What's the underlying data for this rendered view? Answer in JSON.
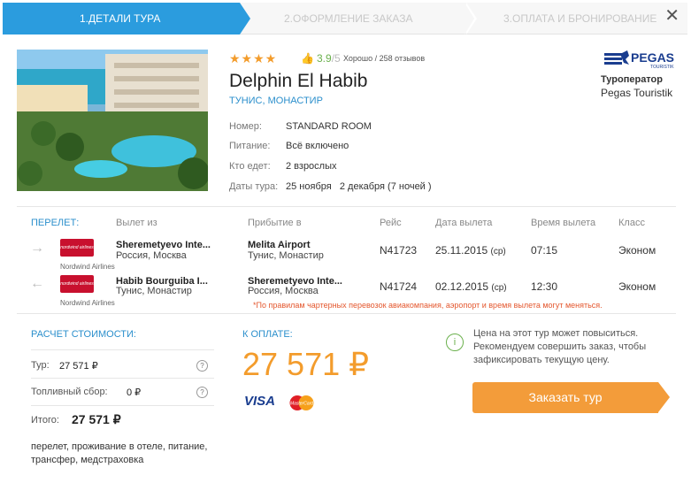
{
  "steps": [
    "1.Детали тура",
    "2.Оформление заказа",
    "3.Оплата и бронирование"
  ],
  "colors": {
    "accent": "#2b9cde",
    "orange": "#f39c3a",
    "green": "#6ab04c"
  },
  "hotel": {
    "stars": "★★★★",
    "rating": "3.9",
    "rating_of": "/5",
    "rating_text": "Хорошо / 258 отзывов",
    "name": "Delphin El Habib",
    "location": "Тунис, Монастир",
    "details": [
      {
        "label": "Номер:",
        "value": "STANDARD ROOM"
      },
      {
        "label": "Питание:",
        "value": "Всё включено"
      },
      {
        "label": "Кто едет:",
        "value": "2 взрослых"
      },
      {
        "label": "Даты тура:",
        "value": "25 ноября   2 декабря (7 ночей )"
      }
    ]
  },
  "operator": {
    "logo_text": "PEGAS",
    "logo_sub": "TOURISTIK",
    "label": "Туроператор",
    "name": "Pegas Touristik"
  },
  "flights": {
    "headers": [
      "Перелет:",
      "Вылет из",
      "Прибытие в",
      "Рейс",
      "Дата вылета",
      "Время вылета",
      "Класс"
    ],
    "rows": [
      {
        "direction": "→",
        "airline_logo": "nordwind airlines",
        "airline": "Nordwind Airlines",
        "from_name": "Sheremetyevo Inte...",
        "from_place": "Россия, Москва",
        "to_name": "Melita Airport",
        "to_place": "Тунис, Монастир",
        "flight": "N41723",
        "date": "25.11.2015",
        "day": "(ср)",
        "time": "07:15",
        "class": "Эконом"
      },
      {
        "direction": "←",
        "airline_logo": "nordwind airlines",
        "airline": "Nordwind Airlines",
        "from_name": "Habib Bourguiba I...",
        "from_place": "Тунис, Монастир",
        "to_name": "Sheremetyevo Inte...",
        "to_place": "Россия, Москва",
        "flight": "N41724",
        "date": "02.12.2015",
        "day": "(ср)",
        "time": "12:30",
        "class": "Эконом"
      }
    ],
    "warning": "*По правилам чартерных перевозок авиакомпания, аэропорт и время вылета могут меняться."
  },
  "cost": {
    "title": "Расчет стоимости:",
    "tour_label": "Тур:",
    "tour_value": "27 571 ₽",
    "fuel_label": "Топливный сбор:",
    "fuel_value": "0 ₽",
    "total_label": "Итого:",
    "total_value": "27 571 ₽",
    "includes": "перелет, проживание в отеле, питание, трансфер, медстраховка"
  },
  "payment": {
    "title": "К оплате:",
    "amount": "27 571 ₽",
    "visa": "VISA",
    "mastercard": "MasterCard",
    "info": "Цена на этот тур может повыситься. Рекомендуем совершить заказ, чтобы зафиксировать текущую цену.",
    "order_button": "Заказать тур"
  }
}
